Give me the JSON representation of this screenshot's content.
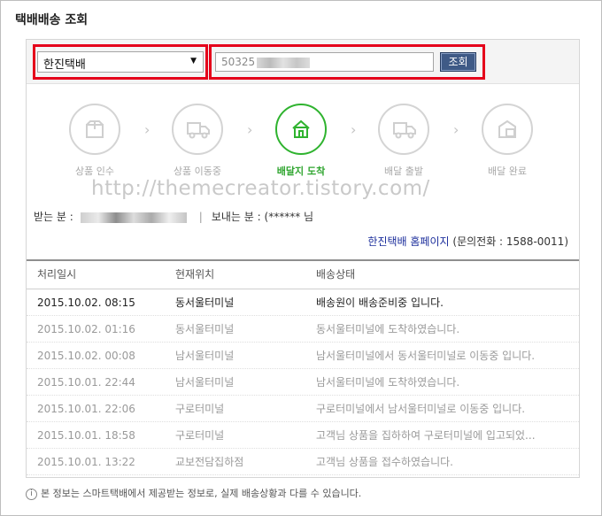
{
  "page_title": "택배배송 조회",
  "search": {
    "carrier_selected": "한진택배",
    "tracking_value": "50325",
    "button_label": "조회"
  },
  "steps": [
    {
      "label": "상품 인수",
      "icon": "box-icon",
      "active": false
    },
    {
      "label": "상품 이동중",
      "icon": "truck-icon",
      "active": false
    },
    {
      "label": "배달지 도착",
      "icon": "home-icon",
      "active": true
    },
    {
      "label": "배달 출발",
      "icon": "delivery-truck-icon",
      "active": false
    },
    {
      "label": "배달 완료",
      "icon": "delivered-box-icon",
      "active": false
    }
  ],
  "watermark": "http://themecreator.tistory.com/",
  "recipient": {
    "receiver_label": "받는 분 :",
    "sender_label": "보내는 분 :",
    "sender_value": "(****** 님"
  },
  "carrier_link": {
    "link_text": "한진택배 홈페이지",
    "phone_text": "(문의전화 : 1588-0011)"
  },
  "table": {
    "headers": [
      "처리일시",
      "현재위치",
      "배송상태"
    ],
    "rows": [
      [
        "2015.10.02. 08:15",
        "동서울터미널",
        "배송원이 배송준비중 입니다."
      ],
      [
        "2015.10.02. 01:16",
        "동서울터미널",
        "동서울터미널에 도착하였습니다."
      ],
      [
        "2015.10.02. 00:08",
        "남서울터미널",
        "남서울터미널에서 동서울터미널로 이동중 입니다."
      ],
      [
        "2015.10.01. 22:44",
        "남서울터미널",
        "남서울터미널에 도착하였습니다."
      ],
      [
        "2015.10.01. 22:06",
        "구로터미널",
        "구로터미널에서 남서울터미널로 이동중 입니다."
      ],
      [
        "2015.10.01. 18:58",
        "구로터미널",
        "고객님 상품을 집하하여 구로터미널에 입고되었..."
      ],
      [
        "2015.10.01. 13:22",
        "교보전담집하점",
        "고객님 상품을 접수하였습니다."
      ]
    ]
  },
  "notice": "본 정보는 스마트택배에서 제공받는 정보로, 실제 배송상황과 다를 수 있습니다.",
  "colors": {
    "highlight_red": "#e5001a",
    "active_green": "#2fb32f",
    "button_navy": "#3f5a86",
    "link_blue": "#1d2f9c"
  }
}
